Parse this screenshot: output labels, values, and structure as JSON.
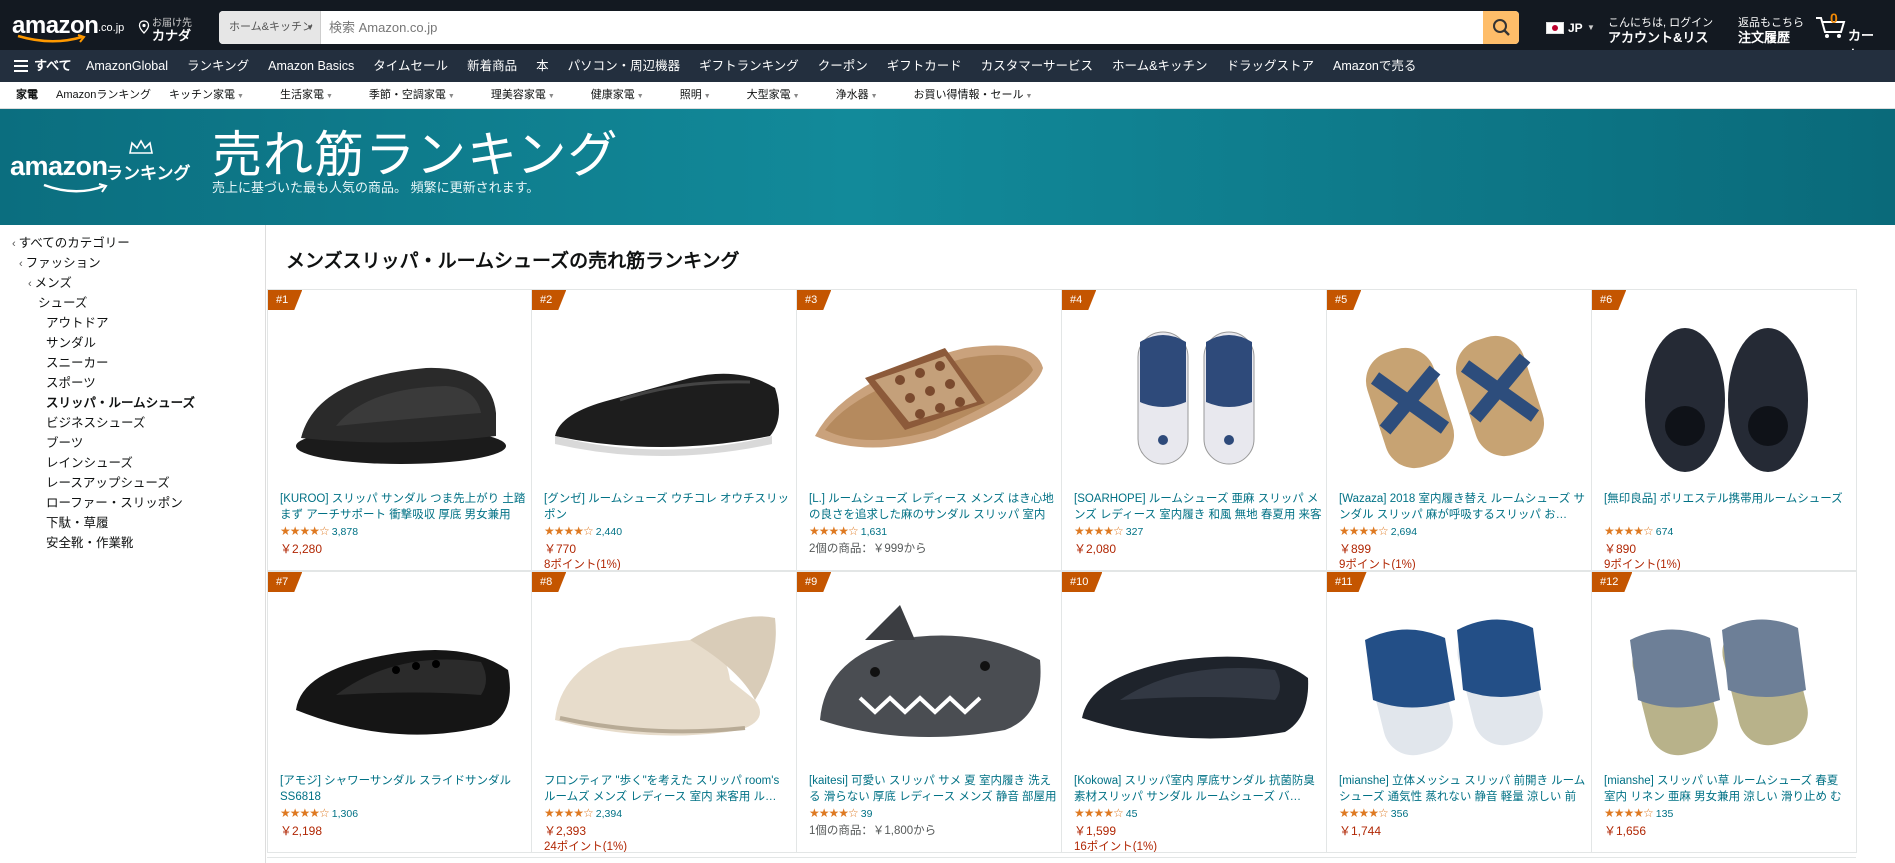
{
  "header": {
    "logo_word": "amazon",
    "logo_tld": ".co.jp",
    "deliver_line1": "お届け先",
    "deliver_line2": "カナダ",
    "search_dept": "ホーム&キッチン",
    "search_placeholder": "検索 Amazon.co.jp",
    "lang": "JP",
    "account_line1": "こんにちは, ログイン",
    "account_line2": "アカウント&リスト",
    "orders_line1": "返品もこちら",
    "orders_line2": "注文履歴",
    "cart_count": "0",
    "cart_label": "カート"
  },
  "nav_main": {
    "all_label": "すべて",
    "links": [
      "AmazonGlobal",
      "ランキング",
      "Amazon Basics",
      "タイムセール",
      "新着商品",
      "本",
      "パソコン・周辺機器",
      "ギフトランキング",
      "クーポン",
      "ギフトカード",
      "カスタマーサービス",
      "ホーム&キッチン",
      "ドラッグストア",
      "Amazonで売る"
    ]
  },
  "nav_sub": {
    "links": [
      "家電",
      "Amazonランキング",
      "キッチン家電",
      "生活家電",
      "季節・空調家電",
      "理美容家電",
      "健康家電",
      "照明",
      "大型家電",
      "浄水器",
      "お買い得情報・セール"
    ]
  },
  "banner": {
    "brand_word": "amazon",
    "brand_sub": "ランキング",
    "title": "売れ筋ランキング",
    "subtitle": "売上に基づいた最も人気の商品。 頻繁に更新されます。"
  },
  "sidebar": {
    "items": [
      {
        "label": "すべてのカテゴリー"
      },
      {
        "label": "ファッション"
      },
      {
        "label": "メンズ"
      },
      {
        "label": "シューズ"
      },
      {
        "label": "アウトドア"
      },
      {
        "label": "サンダル"
      },
      {
        "label": "スニーカー"
      },
      {
        "label": "スポーツ"
      },
      {
        "label": "スリッパ・ルームシューズ"
      },
      {
        "label": "ビジネスシューズ"
      },
      {
        "label": "ブーツ"
      },
      {
        "label": "レインシューズ"
      },
      {
        "label": "レースアップシューズ"
      },
      {
        "label": "ローファー・スリッポン"
      },
      {
        "label": "下駄・草履"
      },
      {
        "label": "安全靴・作業靴"
      }
    ]
  },
  "main": {
    "heading": "メンズスリッパ・ルームシューズの売れ筋ランキング",
    "products": [
      {
        "rank": "#1",
        "name": "[KUROO] スリッパ サンダル つま先上がり 土踏まず アーチサポート 衝撃吸収 厚底 男女兼用",
        "stars": "★★★★☆",
        "reviews": "3,878",
        "price": "￥2,280",
        "extra": "",
        "image": "black-slide"
      },
      {
        "rank": "#2",
        "name": "[グンゼ] ルームシューズ ウチコレ オウチスリッポン",
        "stars": "★★★★☆",
        "reviews": "2,440",
        "price": "￥770",
        "extra": "8ポイント(1%)",
        "image": "black-mesh-slipon"
      },
      {
        "rank": "#3",
        "name": "[L.] ルームシューズ レディース メンズ はき心地の良さを追求した麻のサンダル スリッパ 室内 室内履き 洗える おしゃれ ベランダ",
        "stars": "★★★★☆",
        "reviews": "1,631",
        "price": "",
        "extra": "2個の商品：￥999から",
        "image": "linen-slipper"
      },
      {
        "rank": "#4",
        "name": "[SOARHOPE] ルームシューズ 亜麻 スリッパ メンズ レディース 室内履き 和風 無地 春夏用 来客用 部屋用 軽量 オシャレ 通気 疲れない …",
        "stars": "★★★★☆",
        "reviews": "327",
        "price": "￥2,080",
        "extra": "",
        "image": "navy-slipper-pair"
      },
      {
        "rank": "#5",
        "name": "[Wazaza] 2018 室内履き替え ルームシューズ サンダル スリッパ 麻が呼吸するスリッパ お…",
        "stars": "★★★★☆",
        "reviews": "2,694",
        "price": "￥899",
        "extra": "9ポイント(1%)",
        "image": "cross-strap-slipper"
      },
      {
        "rank": "#6",
        "name": "[無印良品] ポリエステル携帯用ルームシューズ",
        "stars": "★★★★☆",
        "reviews": "674",
        "price": "￥890",
        "extra": "9ポイント(1%)",
        "image": "black-travel-slipper"
      },
      {
        "rank": "#7",
        "name": "[アモジ] シャワーサンダル スライドサンダル SS6818",
        "stars": "★★★★☆",
        "reviews": "1,306",
        "price": "￥2,198",
        "extra": "",
        "image": "black-shower-slide"
      },
      {
        "rank": "#8",
        "name": "フロンティア \"歩く\"を考えた スリッパ room's ルームズ メンズ レディース 室内 来客用 ル…",
        "stars": "★★★★☆",
        "reviews": "2,394",
        "price": "￥2,393",
        "extra": "24ポイント(1%)",
        "image": "cream-mule"
      },
      {
        "rank": "#9",
        "name": "[kaitesi] 可愛い スリッパ サメ 夏 室内履き 洗える 滑らない 厚底 レディース メンズ 静音 部屋用 ルームシューズ サンダル ルームスリッ…",
        "stars": "★★★★☆",
        "reviews": "39",
        "price": "",
        "extra": "1個の商品：￥1,800から",
        "image": "shark-slide"
      },
      {
        "rank": "#10",
        "name": "[Kokowa] スリッパ室内 厚底サンダル 抗菌防臭素材スリッパ サンダル ルームシューズ バ…",
        "stars": "★★★★☆",
        "reviews": "45",
        "price": "￥1,599",
        "extra": "16ポイント(1%)",
        "image": "black-thick-slide"
      },
      {
        "rank": "#11",
        "name": "[mianshe] 立体メッシュ スリッパ 前開き ルームシューズ 通気性 蒸れない 静音 軽量 涼しい 前開き 外縫い 室内はき メンズ レディース",
        "stars": "★★★★☆",
        "reviews": "356",
        "price": "￥1,744",
        "extra": "",
        "image": "blue-mesh-slipper"
      },
      {
        "rank": "#12",
        "name": "[mianshe] スリッパ い草 ルームシューズ 春夏 室内 リネン 亜麻 男女兼用 涼しい 滑り止め むれない 室内はき 軽量 前開き 無地 井草",
        "stars": "★★★★☆",
        "reviews": "135",
        "price": "￥1,656",
        "extra": "",
        "image": "gray-tatami-slipper"
      }
    ]
  },
  "colors": {
    "nav_dark": "#131921",
    "nav_mid": "#232f3e",
    "search_button": "#febd69",
    "banner_teal": "#128a9a",
    "rank_badge": "#c45500",
    "link": "#007185",
    "price": "#b12704",
    "star": "#de7921"
  }
}
